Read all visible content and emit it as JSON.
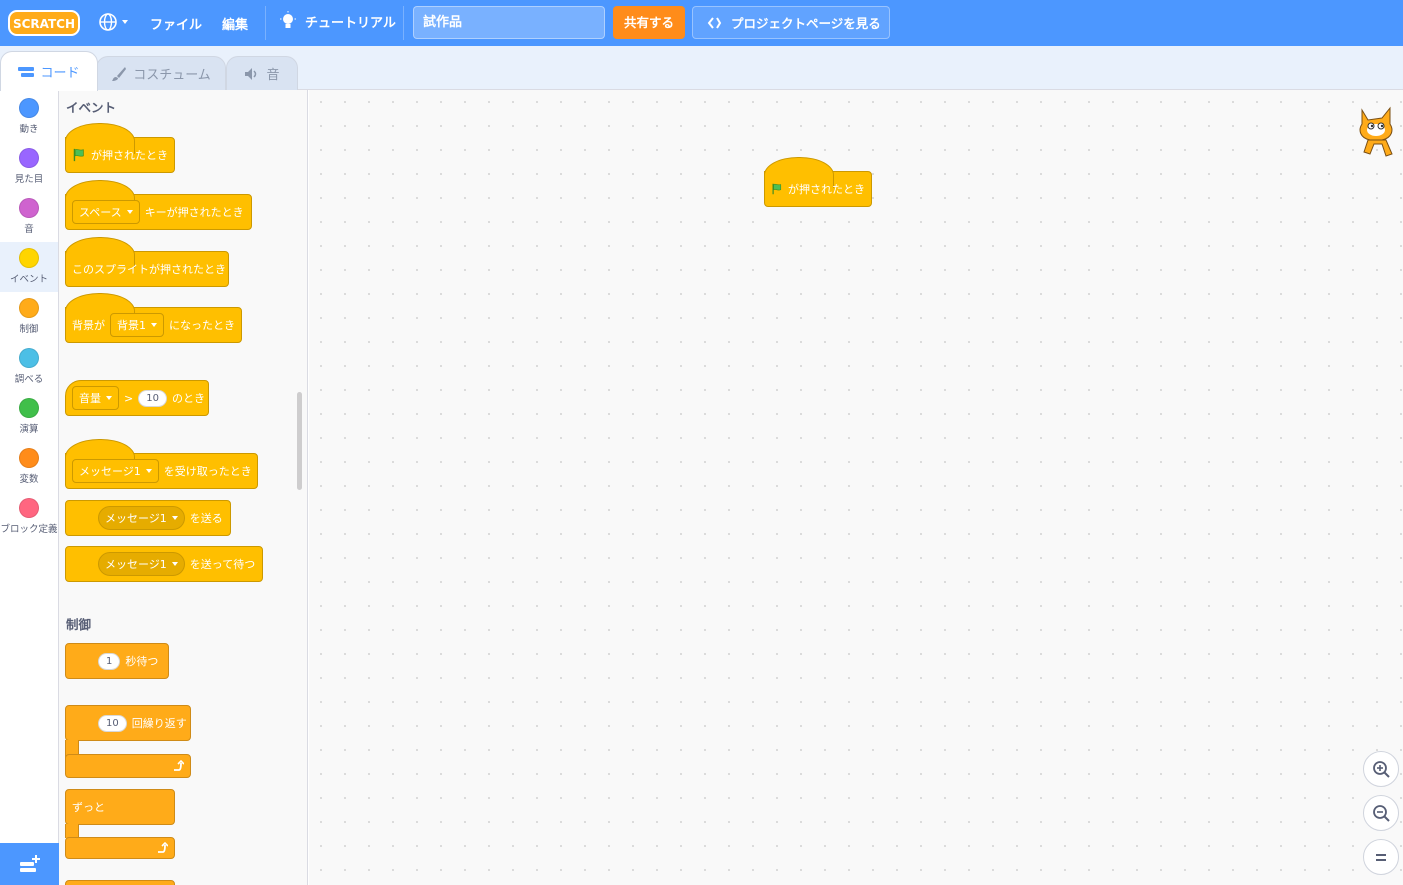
{
  "menubar": {
    "logo": "SCRATCH",
    "file": "ファイル",
    "edit": "編集",
    "tutorial": "チュートリアル",
    "project_title": "試作品",
    "share": "共有する",
    "project_page": "プロジェクトページを見る"
  },
  "tabs": [
    "コード",
    "コスチューム",
    "音"
  ],
  "categories": [
    {
      "label": "動き",
      "color": "#4c97ff"
    },
    {
      "label": "見た目",
      "color": "#9966ff"
    },
    {
      "label": "音",
      "color": "#cf63cf"
    },
    {
      "label": "イベント",
      "color": "#ffd500"
    },
    {
      "label": "制御",
      "color": "#ffab19"
    },
    {
      "label": "調べる",
      "color": "#4cbfe6"
    },
    {
      "label": "演算",
      "color": "#40bf4a"
    },
    {
      "label": "変数",
      "color": "#ff8c1a"
    },
    {
      "label": "ブロック定義",
      "color": "#ff6680"
    }
  ],
  "palette": {
    "events_heading": "イベント",
    "flag_clicked": "が押されたとき",
    "key_dropdown": "スペース",
    "key_pressed": "キーが押されたとき",
    "sprite_clicked": "このスプライトが押されたとき",
    "backdrop_prefix": "背景が",
    "backdrop_dropdown": "背景1",
    "backdrop_suffix": "になったとき",
    "loudness_dropdown": "音量",
    "gt": ">",
    "loudness_value": "10",
    "loudness_suffix": "のとき",
    "message_dropdown": "メッセージ1",
    "receive_suffix": "を受け取ったとき",
    "broadcast_suffix": "を送る",
    "broadcast_wait_suffix": "を送って待つ",
    "control_heading": "制御",
    "wait_value": "1",
    "wait_suffix": "秒待つ",
    "repeat_value": "10",
    "repeat_suffix": "回繰り返す",
    "forever": "ずっと"
  },
  "workspace": {
    "script_block": "が押されたとき"
  }
}
